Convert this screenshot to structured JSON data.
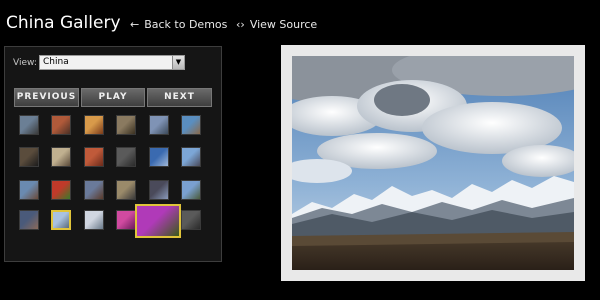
{
  "header": {
    "title": "China Gallery",
    "back_link": "Back to Demos",
    "back_icon": "arrow-left-icon",
    "source_link": "View Source",
    "source_icon": "code-brackets-icon"
  },
  "panel": {
    "view_label": "View:",
    "view_selected": "China",
    "buttons": {
      "previous": "PREVIOUS",
      "play": "PLAY",
      "next": "NEXT"
    }
  },
  "colors": {
    "background": "#000000",
    "selection_border": "#e0c43a"
  },
  "thumbnails": [
    {
      "name": "thumb-1",
      "colors": [
        "#6b7f95",
        "#3a3a3a"
      ]
    },
    {
      "name": "thumb-2",
      "colors": [
        "#b05a3a",
        "#4a3025"
      ]
    },
    {
      "name": "thumb-3",
      "colors": [
        "#d89a4a",
        "#7a3a1a"
      ]
    },
    {
      "name": "thumb-4",
      "colors": [
        "#8a7a60",
        "#3a3020"
      ]
    },
    {
      "name": "thumb-5",
      "colors": [
        "#7f93b5",
        "#3c4a5a"
      ]
    },
    {
      "name": "thumb-6",
      "colors": [
        "#5a8ec0",
        "#8a6a4a"
      ]
    },
    {
      "name": "thumb-7",
      "colors": [
        "#5a4c3c",
        "#1c1c1c"
      ]
    },
    {
      "name": "thumb-8",
      "colors": [
        "#c0b090",
        "#5a4a3a"
      ]
    },
    {
      "name": "thumb-9",
      "colors": [
        "#c05a3a",
        "#6a2a1a"
      ]
    },
    {
      "name": "thumb-10",
      "colors": [
        "#5a5a5a",
        "#2a2a2a"
      ]
    },
    {
      "name": "thumb-11",
      "colors": [
        "#3a6ab0",
        "#a0b8d8"
      ]
    },
    {
      "name": "thumb-12",
      "colors": [
        "#7ca6d6",
        "#4a4a5a"
      ]
    },
    {
      "name": "thumb-13",
      "colors": [
        "#6a8ab0",
        "#6a4a3a"
      ]
    },
    {
      "name": "thumb-14",
      "colors": [
        "#c03a2a",
        "#3a7a2a"
      ]
    },
    {
      "name": "thumb-15",
      "colors": [
        "#6a7a9a",
        "#5a3a2a"
      ]
    },
    {
      "name": "thumb-16",
      "colors": [
        "#9a8a6a",
        "#3a3a3a"
      ]
    },
    {
      "name": "thumb-17",
      "colors": [
        "#4a4a5a",
        "#8a9aba"
      ]
    },
    {
      "name": "thumb-18",
      "colors": [
        "#7aa0d0",
        "#4a5a3a"
      ]
    },
    {
      "name": "thumb-19",
      "colors": [
        "#4a5a7a",
        "#8a6a5a"
      ]
    },
    {
      "name": "thumb-20",
      "colors": [
        "#a9c2e0",
        "#5a6a7a"
      ]
    },
    {
      "name": "thumb-21",
      "colors": [
        "#d0d6e0",
        "#6a7a8a"
      ]
    },
    {
      "name": "thumb-22",
      "colors": [
        "#d04aa0",
        "#6a1a5a"
      ]
    },
    {
      "name": "thumb-23",
      "colors": [
        "#b03ab8",
        "#3a5a1a"
      ]
    },
    {
      "name": "thumb-24",
      "colors": [
        "#5a5a5a",
        "#2a2a2a"
      ]
    }
  ]
}
